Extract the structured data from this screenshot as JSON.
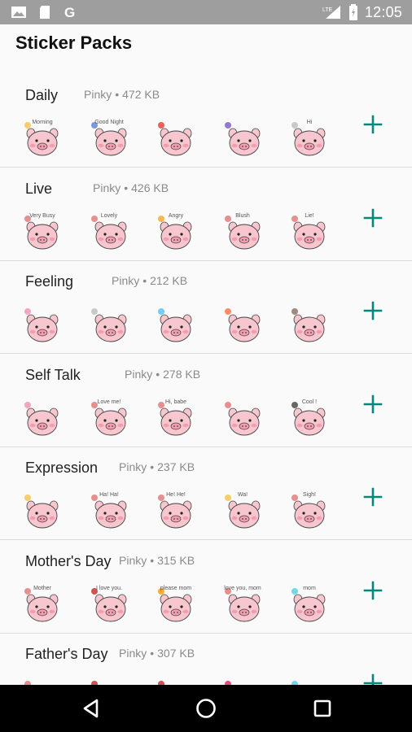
{
  "status_bar": {
    "time": "12:05",
    "left_icons": [
      "gallery-icon",
      "sd-card-icon",
      "google-icon"
    ],
    "right_icons": [
      "lte-signal-icon",
      "battery-icon"
    ]
  },
  "app_bar": {
    "title": "Sticker Packs"
  },
  "packs": [
    {
      "name": "Daily",
      "author": "Pinky",
      "size": "472 KB",
      "stickers": [
        {
          "caption": "Morning",
          "accent": "#f5c242"
        },
        {
          "caption": "Good Night",
          "accent": "#5a7fd6"
        },
        {
          "caption": "",
          "accent": "#e53935"
        },
        {
          "caption": "",
          "accent": "#7e57c2"
        },
        {
          "caption": "Hi",
          "accent": "#bdbdbd"
        }
      ]
    },
    {
      "name": "Live",
      "author": "Pinky",
      "size": "426 KB",
      "stickers": [
        {
          "caption": "Very Busy",
          "accent": "#e57373"
        },
        {
          "caption": "Lovely",
          "accent": "#e57373"
        },
        {
          "caption": "Angry",
          "accent": "#f9a825"
        },
        {
          "caption": "Blush",
          "accent": "#e57373"
        },
        {
          "caption": "Lie!",
          "accent": "#e57373"
        }
      ]
    },
    {
      "name": "Feeling",
      "author": "Pinky",
      "size": "212 KB",
      "stickers": [
        {
          "caption": "",
          "accent": "#f48fb1"
        },
        {
          "caption": "",
          "accent": "#bdbdbd"
        },
        {
          "caption": "",
          "accent": "#4fc3f7"
        },
        {
          "caption": "",
          "accent": "#ff7043"
        },
        {
          "caption": "",
          "accent": "#8d6e63"
        }
      ]
    },
    {
      "name": "Self Talk",
      "author": "Pinky",
      "size": "278 KB",
      "stickers": [
        {
          "caption": "",
          "accent": "#f48fb1"
        },
        {
          "caption": "Love me!",
          "accent": "#e57373"
        },
        {
          "caption": "Hi, babe",
          "accent": "#e57373"
        },
        {
          "caption": "",
          "accent": "#e57373"
        },
        {
          "caption": "Cool !",
          "accent": "#424242"
        }
      ]
    },
    {
      "name": "Expression",
      "author": "Pinky",
      "size": "237 KB",
      "stickers": [
        {
          "caption": "",
          "accent": "#f5c242"
        },
        {
          "caption": "Ha! Ha!",
          "accent": "#e57373"
        },
        {
          "caption": "He! He!",
          "accent": "#e57373"
        },
        {
          "caption": "Wa!",
          "accent": "#f5c242"
        },
        {
          "caption": "Sigh!",
          "accent": "#e57373"
        }
      ]
    },
    {
      "name": "Mother's Day",
      "author": "Pinky",
      "size": "315 KB",
      "stickers": [
        {
          "caption": "Mother",
          "accent": "#e57373"
        },
        {
          "caption": "I love you.",
          "accent": "#c62828"
        },
        {
          "caption": "please mom",
          "accent": "#ff9800"
        },
        {
          "caption": "love you, mom",
          "accent": "#e57373"
        },
        {
          "caption": "mom",
          "accent": "#4dd0e1"
        }
      ]
    },
    {
      "name": "Father's Day",
      "author": "Pinky",
      "size": "307 KB",
      "stickers": [
        {
          "caption": "",
          "accent": "#e57373"
        },
        {
          "caption": "",
          "accent": "#c62828"
        },
        {
          "caption": "",
          "accent": "#c62828"
        },
        {
          "caption": "",
          "accent": "#e91e63"
        },
        {
          "caption": "",
          "accent": "#4dd0e1"
        }
      ]
    }
  ],
  "colors": {
    "accent": "#00897b",
    "status_bar": "#9e9e9e",
    "nav_bar": "#000000",
    "pig": "#f7c6cf"
  },
  "nav_bar": {
    "buttons": [
      "back-icon",
      "home-icon",
      "recents-icon"
    ]
  }
}
